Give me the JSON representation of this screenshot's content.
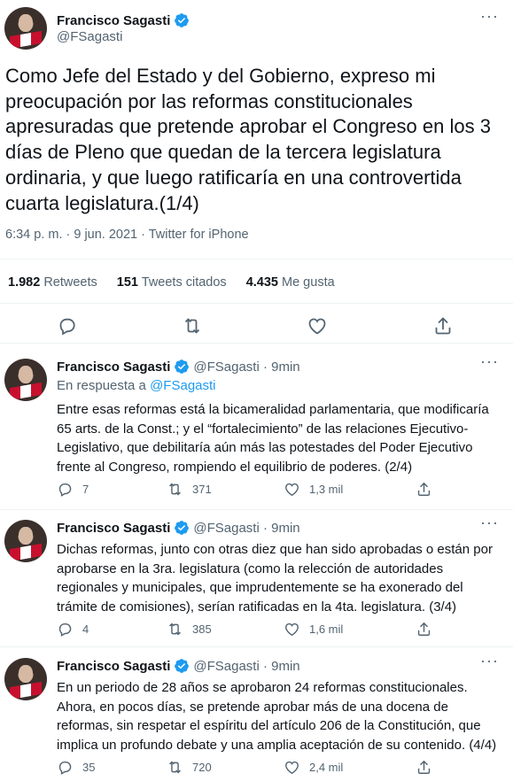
{
  "main_tweet": {
    "author_name": "Francisco Sagasti",
    "author_handle": "@FSagasti",
    "text": "Como Jefe del Estado y del Gobierno, expreso mi preocupación por las reformas constitucionales apresuradas que pretende aprobar el Congreso en los 3 días de Pleno que quedan de la tercera legislatura ordinaria, y que luego ratificaría en una controvertida cuarta legislatura.(1/4)",
    "timestamp": "6:34 p. m. · 9 jun. 2021 · Twitter for iPhone",
    "retweets_count": "1.982",
    "retweets_label": "Retweets",
    "quotes_count": "151",
    "quotes_label": "Tweets citados",
    "likes_count": "4.435",
    "likes_label": "Me gusta"
  },
  "replies": [
    {
      "author_name": "Francisco Sagasti",
      "handle_time": "@FSagasti · 9min",
      "replying_prefix": "En respuesta a ",
      "replying_handle": "@FSagasti",
      "text": "Entre esas reformas está la bicameralidad parlamentaria, que modificaría 65 arts. de la Const.; y el “fortalecimiento” de las relaciones Ejecutivo-Legislativo, que debilitaría aún más las potestades del Poder Ejecutivo frente al Congreso, rompiendo el equilibrio de poderes. (2/4)",
      "replies": "7",
      "retweets": "371",
      "likes": "1,3 mil"
    },
    {
      "author_name": "Francisco Sagasti",
      "handle_time": "@FSagasti · 9min",
      "text": "Dichas reformas, junto con otras diez que han sido aprobadas o están por aprobarse en la 3ra. legislatura (como la relección de autoridades regionales y municipales, que imprudentemente se ha exonerado del trámite de comisiones), serían ratificadas en la 4ta. legislatura. (3/4)",
      "replies": "4",
      "retweets": "385",
      "likes": "1,6 mil"
    },
    {
      "author_name": "Francisco Sagasti",
      "handle_time": "@FSagasti · 9min",
      "text": "En un periodo de 28 años se aprobaron 24 reformas constitucionales. Ahora, en pocos días, se pretende aprobar más de una docena de reformas, sin respetar el espíritu del artículo 206 de la Constitución, que implica un profundo debate y una amplia aceptación de su contenido. (4/4)",
      "replies": "35",
      "retweets": "720",
      "likes": "2,4 mil"
    }
  ],
  "colors": {
    "accent": "#1d9bf0",
    "muted": "#536471",
    "text": "#0f1419",
    "divider": "#eff3f4"
  },
  "icons": [
    "verified-badge-icon",
    "more-icon",
    "reply-icon",
    "retweet-icon",
    "like-icon",
    "share-icon"
  ]
}
